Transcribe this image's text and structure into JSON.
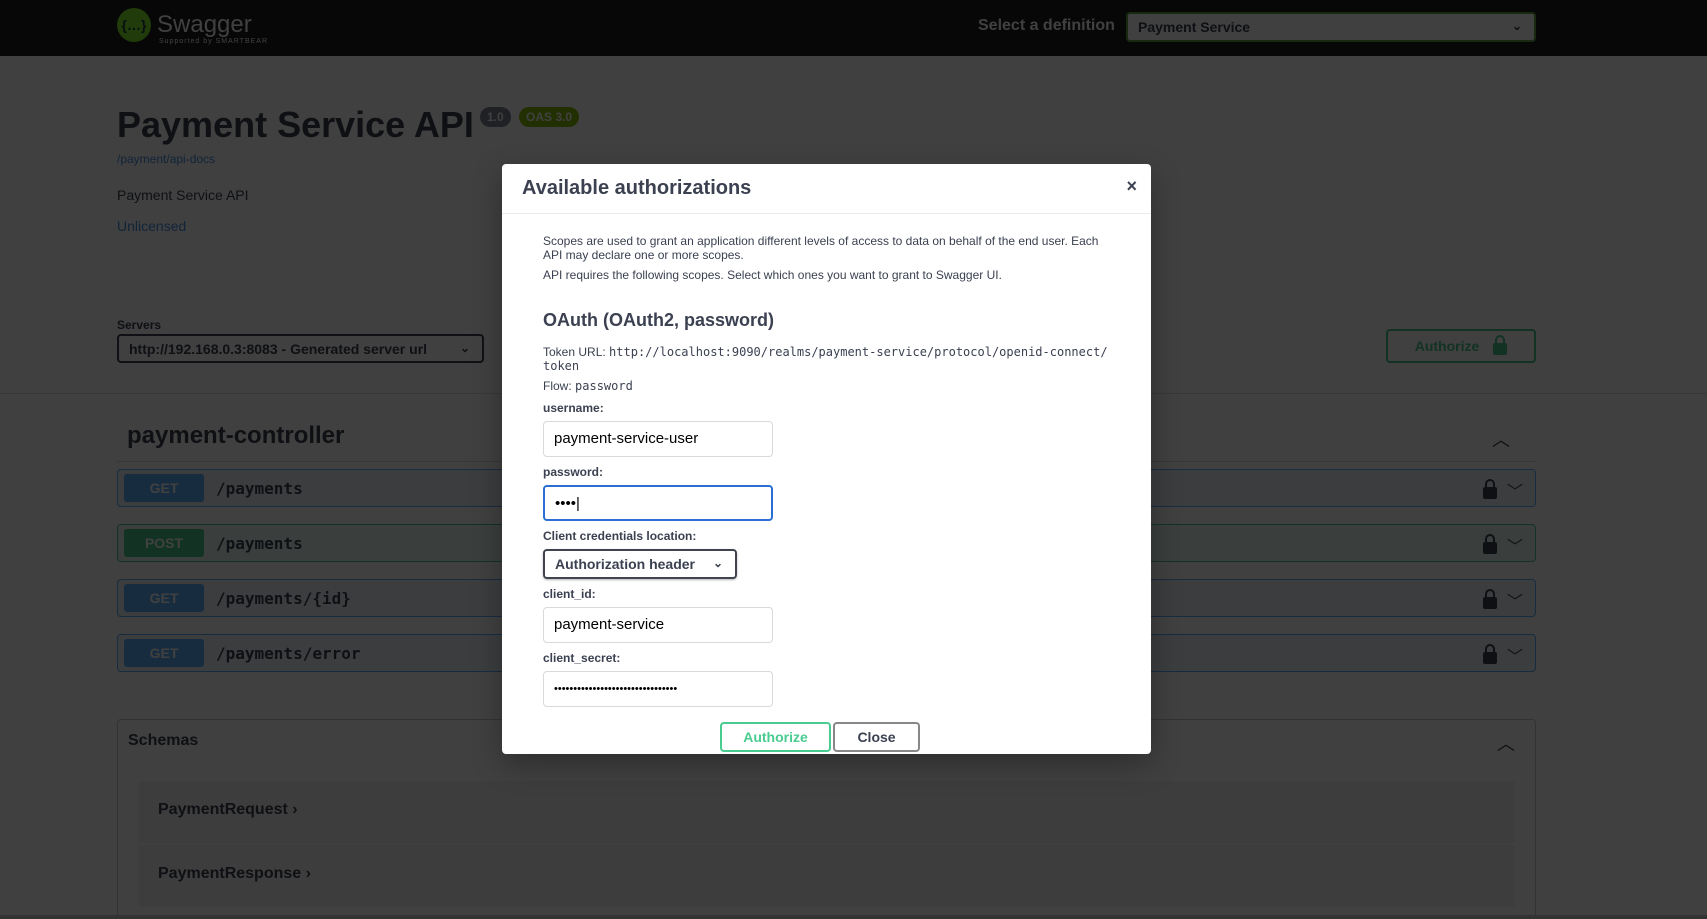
{
  "topbar": {
    "logo_text": "Swagger",
    "logo_sub": "Supported by SMARTBEAR",
    "definition_label": "Select a definition",
    "definition_value": "Payment Service"
  },
  "info": {
    "title": "Payment Service API",
    "version": "1.0",
    "oas": "OAS 3.0",
    "docs_link": "/payment/api-docs",
    "description": "Payment Service API",
    "license": "Unlicensed"
  },
  "servers": {
    "label": "Servers",
    "value": "http://192.168.0.3:8083 - Generated server url"
  },
  "authorize_label": "Authorize",
  "tag": "payment-controller",
  "operations": [
    {
      "method": "GET",
      "path": "/payments"
    },
    {
      "method": "POST",
      "path": "/payments"
    },
    {
      "method": "GET",
      "path": "/payments/{id}"
    },
    {
      "method": "GET",
      "path": "/payments/error"
    }
  ],
  "schemas": {
    "title": "Schemas",
    "items": [
      "PaymentRequest",
      "PaymentResponse"
    ]
  },
  "colors": {
    "get": "#61affe",
    "post": "#49cc90",
    "accent": "#49cc90"
  },
  "modal": {
    "title": "Available authorizations",
    "close_icon": "×",
    "scopes_text": "Scopes are used to grant an application different levels of access to data on behalf of the end user. Each API may declare one or more scopes.",
    "scopes_text2": "API requires the following scopes. Select which ones you want to grant to Swagger UI.",
    "scheme_title": "OAuth (OAuth2, password)",
    "token_url_label": "Token URL:",
    "token_url": "http://localhost:9090/realms/payment-service/protocol/openid-connect/token",
    "flow_label": "Flow:",
    "flow": "password",
    "username_label": "username:",
    "username": "payment-service-user",
    "password_label": "password:",
    "password_mask": "••••",
    "cred_label": "Client credentials location:",
    "cred_value": "Authorization header",
    "client_id_label": "client_id:",
    "client_id": "payment-service",
    "client_secret_label": "client_secret:",
    "client_secret_mask": "••••••••••••••••••••••••••••••••",
    "authorize": "Authorize",
    "close": "Close"
  }
}
